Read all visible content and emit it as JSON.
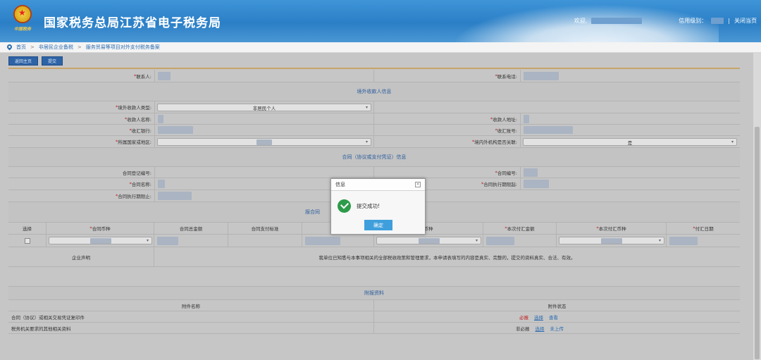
{
  "header": {
    "title": "国家税务总局江苏省电子税务局",
    "emblem_text": "中国税务",
    "welcome": "欢迎,",
    "credit_label": "信用级别：",
    "separator": "|",
    "close_label": "关闭当页"
  },
  "breadcrumb": {
    "home": "首页",
    "sep": ">",
    "level1": "非居民企业备税",
    "level2": "服务贸易等项目对外支付税务备案"
  },
  "toolbar": {
    "back": "返回主页",
    "submit": "提交"
  },
  "form": {
    "contact": "联系人:",
    "phone": "联系电话:",
    "payee_section": "境外收款人信息",
    "payee_type": "境外收款人类型:",
    "payee_type_value": "非居民个人",
    "payee_name": "收款人名称:",
    "payee_address": "收款人地址:",
    "bank": "收汇银行:",
    "account": "收汇账号:",
    "country": "所属国家或地区:",
    "related": "境内外机构是否关联:",
    "related_value": "是",
    "contract_section": "合同（协议或支付凭证）信息",
    "contract_reg_no": "合同登记编号:",
    "contract_no": "合同编号:",
    "contract_name": "合同名称:",
    "contract_start": "合同执行期限起:",
    "contract_end": "合同执行期限止:",
    "payment_section": "报合同",
    "table_headers": [
      "选择",
      "合同币种",
      "合同总金额",
      "合同支付标准",
      "已",
      "币种",
      "本次付汇金额",
      "本次付汇币种",
      "付汇日期"
    ],
    "declaration_label": "企业声明",
    "declaration_text": "我单位已知悉与本事项相关的全部税收政策和管理要求，本申请表填写的内容是真实、完整的，提交的资料真实、合法、有效。",
    "attach_section": "附报资料",
    "attach_name_header": "附件名称",
    "attach_status_header": "附件状态",
    "attachments": [
      {
        "name": "合同（协议）或相关交易凭证复印件",
        "req": "必报",
        "choose": "选择",
        "view": "查看"
      },
      {
        "name": "税务机关要求的其他相关资料",
        "req": "非必报",
        "choose": "选择",
        "view": "未上传"
      }
    ]
  },
  "dialog": {
    "title": "信息",
    "close": "×",
    "message": "提交成功!",
    "confirm": "确定"
  },
  "colors": {
    "header": "#2b7fc6",
    "success": "#2d9b4a",
    "confirm": "#3f9fdc",
    "required": "#c21b1b"
  }
}
